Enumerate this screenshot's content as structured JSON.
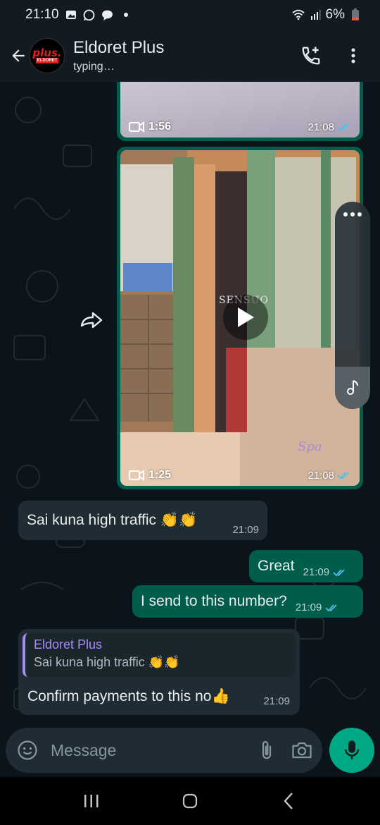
{
  "status_bar": {
    "time": "21:10",
    "battery": "6%"
  },
  "header": {
    "title": "Eldoret Plus",
    "subtitle": "typing…",
    "avatar_text": "plus.",
    "avatar_sub": "ELDORET"
  },
  "media": [
    {
      "duration": "1:56",
      "time": "21:08"
    },
    {
      "duration": "1:25",
      "time": "21:08",
      "overlay_text": "SENSUO",
      "overlay_text2": "Spa"
    }
  ],
  "messages": [
    {
      "text": "Sai kuna high traffic 👏👏",
      "time": "21:09"
    },
    {
      "text": "Great",
      "time": "21:09"
    },
    {
      "text": "I send to this number?",
      "time": "21:09"
    }
  ],
  "reply": {
    "quoted_name": "Eldoret Plus",
    "quoted_text": "Sai kuna high traffic 👏👏",
    "text": "Confirm payments to this no👍",
    "time": "21:09"
  },
  "composer": {
    "placeholder": "Message"
  },
  "colors": {
    "accent": "#00a884",
    "outgoing": "#005c4b",
    "incoming": "#202c33",
    "read_tick": "#53bdeb",
    "quote_name": "#a78ef5"
  }
}
